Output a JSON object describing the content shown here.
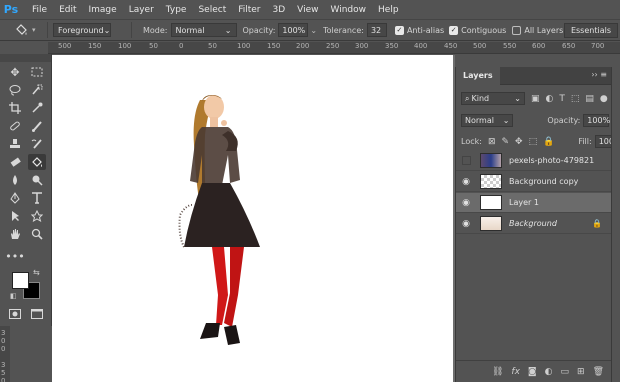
{
  "menu": {
    "logo": "Ps",
    "items": [
      "File",
      "Edit",
      "Image",
      "Layer",
      "Type",
      "Select",
      "Filter",
      "3D",
      "View",
      "Window",
      "Help"
    ]
  },
  "options": {
    "fill_source": "Foreground",
    "mode_label": "Mode:",
    "mode_value": "Normal",
    "opacity_label": "Opacity:",
    "opacity_value": "100%",
    "tolerance_label": "Tolerance:",
    "tolerance_value": "32",
    "anti_alias": "Anti-alias",
    "contiguous": "Contiguous",
    "all_layers": "All Layers",
    "workspace": "Essentials"
  },
  "ruler": {
    "top_ticks": [
      "500",
      "150",
      "100",
      "50",
      "0",
      "50",
      "100",
      "150",
      "200",
      "250",
      "300",
      "350",
      "400",
      "450",
      "500",
      "550",
      "600",
      "650",
      "700"
    ],
    "left_ticks": [
      "3",
      "0",
      "0",
      "3",
      "5",
      "0"
    ]
  },
  "layers_panel": {
    "title": "Layers",
    "filter_kind": "Kind",
    "blend_mode": "Normal",
    "opacity_label": "Opacity:",
    "opacity_value": "100%",
    "lock_label": "Lock:",
    "fill_label": "Fill:",
    "fill_value": "100%",
    "layers": [
      {
        "name": "pexels-photo-479821",
        "visible": false
      },
      {
        "name": "Background copy",
        "visible": true
      },
      {
        "name": "Layer 1",
        "visible": true,
        "selected": true
      },
      {
        "name": "Background",
        "visible": true,
        "locked": true
      }
    ]
  },
  "colors": {
    "foreground": "#ffffff",
    "background": "#000000",
    "ui_panel": "#535353",
    "accent_logo": "#31a8ff"
  }
}
